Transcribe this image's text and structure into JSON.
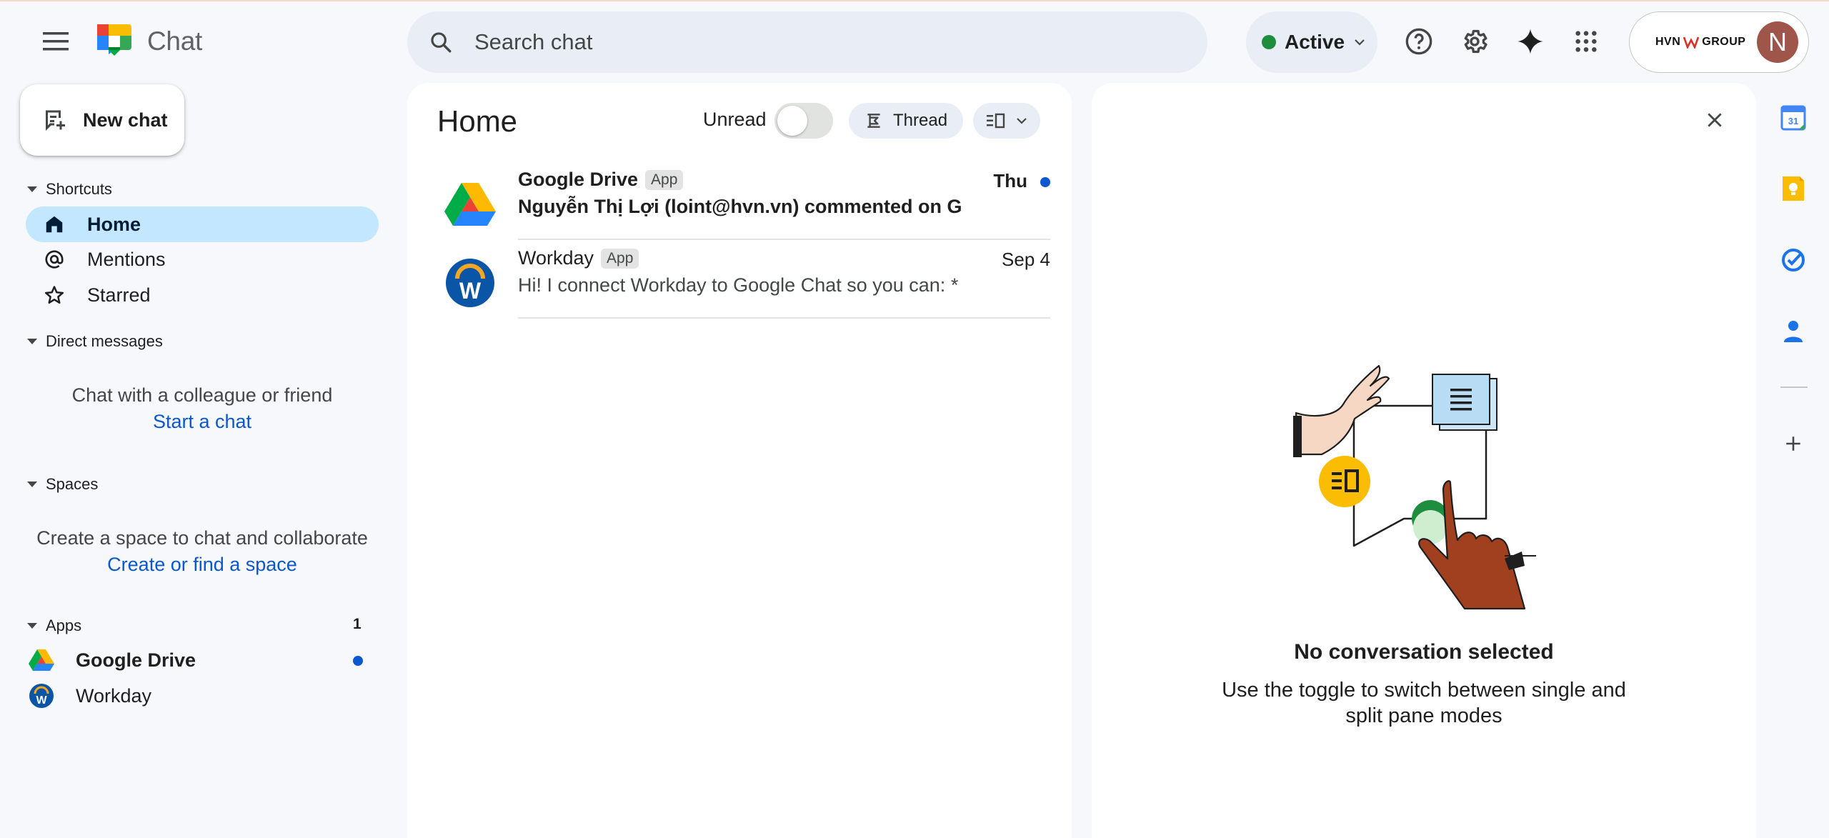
{
  "app": {
    "title": "Chat"
  },
  "search": {
    "placeholder": "Search chat"
  },
  "status": {
    "label": "Active",
    "color": "#1e8e3e"
  },
  "account": {
    "org_left": "HVN",
    "org_right": "GROUP",
    "avatar_initial": "N"
  },
  "new_chat": {
    "label": "New chat"
  },
  "sections": {
    "shortcuts": "Shortcuts",
    "direct_messages": "Direct messages",
    "spaces": "Spaces",
    "apps": "Apps"
  },
  "shortcuts": [
    {
      "label": "Home",
      "icon": "home-icon",
      "active": true
    },
    {
      "label": "Mentions",
      "icon": "at-icon"
    },
    {
      "label": "Starred",
      "icon": "star-icon"
    }
  ],
  "direct_messages": {
    "note": "Chat with a colleague or friend",
    "link": "Start a chat"
  },
  "spaces": {
    "note": "Create a space to chat and collaborate",
    "link": "Create or find a space"
  },
  "apps": {
    "unread_count": "1",
    "items": [
      {
        "label": "Google Drive",
        "icon": "google-drive-icon",
        "unread": true
      },
      {
        "label": "Workday",
        "icon": "workday-icon",
        "unread": false
      }
    ]
  },
  "home": {
    "title": "Home",
    "unread_label": "Unread",
    "unread_on": false,
    "thread_label": "Thread",
    "conversations": [
      {
        "name": "Google Drive",
        "tag": "App",
        "date": "Thu",
        "preview": "Nguyễn Thị Lợi (loint@hvn.vn) commented on Go...",
        "unread": true
      },
      {
        "name": "Workday",
        "tag": "App",
        "date": "Sep 4",
        "preview": "Hi! I connect Workday to Google Chat so you can: * R...",
        "unread": false
      }
    ]
  },
  "detail": {
    "empty_title": "No conversation selected",
    "empty_subtitle": "Use the toggle to switch between single and split pane modes"
  },
  "side_rail": [
    "calendar-icon",
    "keep-icon",
    "tasks-icon",
    "contacts-icon",
    "add-icon"
  ],
  "colors": {
    "accent": "#0b57d0",
    "active_nav": "#c2e7ff",
    "background": "#f6f8fc"
  }
}
